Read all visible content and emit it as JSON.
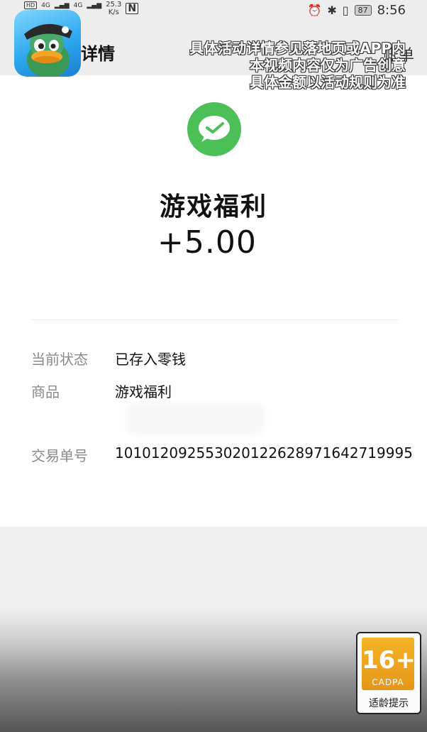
{
  "status_bar": {
    "hd": "HD",
    "signal1": "4G",
    "signal2": "4G",
    "net_rate_value": "25.3",
    "net_rate_unit": "K/s",
    "nfc": "N",
    "battery": "87",
    "time": "8:56"
  },
  "header": {
    "title": "详情",
    "right_action": "账单"
  },
  "ad_overlay": [
    "具体活动详情参见落地页或APP内",
    "本视频内容仅为广告创意",
    "具体金额以活动规则为准"
  ],
  "transaction": {
    "title": "游戏福利",
    "amount": "+5.00",
    "rows": [
      {
        "label": "当前状态",
        "value": "已存入零钱"
      },
      {
        "label": "商品",
        "value": "游戏福利"
      },
      {
        "label": "交易单号",
        "value": "101012092553020122628971642719995"
      }
    ]
  },
  "age_badge": {
    "rating": "16+",
    "org": "CADPA",
    "caption": "适龄提示"
  },
  "colors": {
    "wechat_green": "#4cbf57",
    "badge_orange": "#f0a720"
  }
}
